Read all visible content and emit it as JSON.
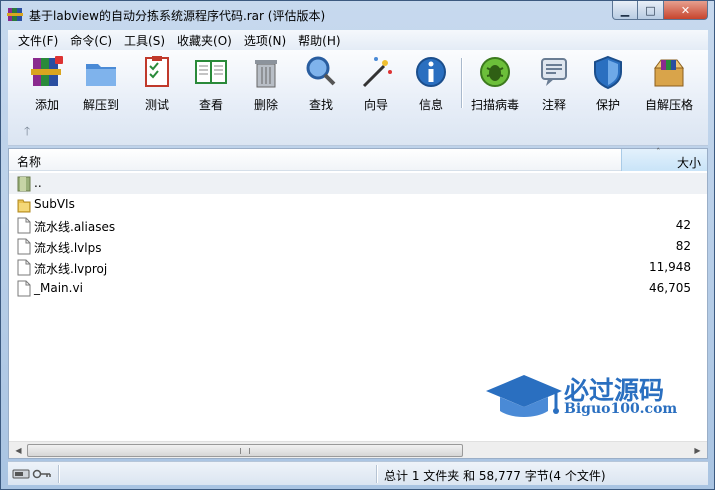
{
  "window": {
    "title": "基于labview的自动分拣系统源程序代码.rar (评估版本)",
    "app_icon": "winrar-books-icon",
    "buttons": {
      "minimize": "▁",
      "maximize": "□",
      "close": "✕"
    }
  },
  "menu": [
    "文件(F)",
    "命令(C)",
    "工具(S)",
    "收藏夹(O)",
    "选项(N)",
    "帮助(H)"
  ],
  "toolbar": {
    "buttons": [
      {
        "label": "添加",
        "icon": "add-archive-icon"
      },
      {
        "label": "解压到",
        "icon": "extract-to-icon"
      },
      {
        "label": "测试",
        "icon": "test-icon"
      },
      {
        "label": "查看",
        "icon": "view-book-icon"
      },
      {
        "label": "删除",
        "icon": "delete-trash-icon"
      },
      {
        "label": "查找",
        "icon": "find-magnifier-icon"
      },
      {
        "label": "向导",
        "icon": "wizard-wand-icon"
      },
      {
        "label": "信息",
        "icon": "info-icon"
      },
      {
        "label": "扫描病毒",
        "icon": "virus-scan-icon"
      },
      {
        "label": "注释",
        "icon": "comment-icon"
      },
      {
        "label": "保护",
        "icon": "protect-shield-icon"
      },
      {
        "label": "自解压格",
        "icon": "sfx-box-icon"
      }
    ],
    "up_arrow": "🡑"
  },
  "filelist": {
    "columns": {
      "name": "名称",
      "size": "大小"
    },
    "sort_indicator": "ˆ",
    "rows": [
      {
        "name": "..",
        "size": "",
        "type": "parent-folder"
      },
      {
        "name": "SubVIs",
        "size": "",
        "type": "folder"
      },
      {
        "name": "流水线.aliases",
        "size": "42",
        "type": "file"
      },
      {
        "name": "流水线.lvlps",
        "size": "82",
        "type": "file"
      },
      {
        "name": "流水线.lvproj",
        "size": "11,948",
        "type": "file"
      },
      {
        "name": "_Main.vi",
        "size": "46,705",
        "type": "file"
      }
    ]
  },
  "watermark": {
    "title": "必过源码",
    "subtitle": "Biguo100.com"
  },
  "statusbar": {
    "summary": "总计 1 文件夹 和 58,777 字节(4 个文件)"
  },
  "colors": {
    "folder": "#e8c050",
    "accent": "#2a6fc0"
  }
}
